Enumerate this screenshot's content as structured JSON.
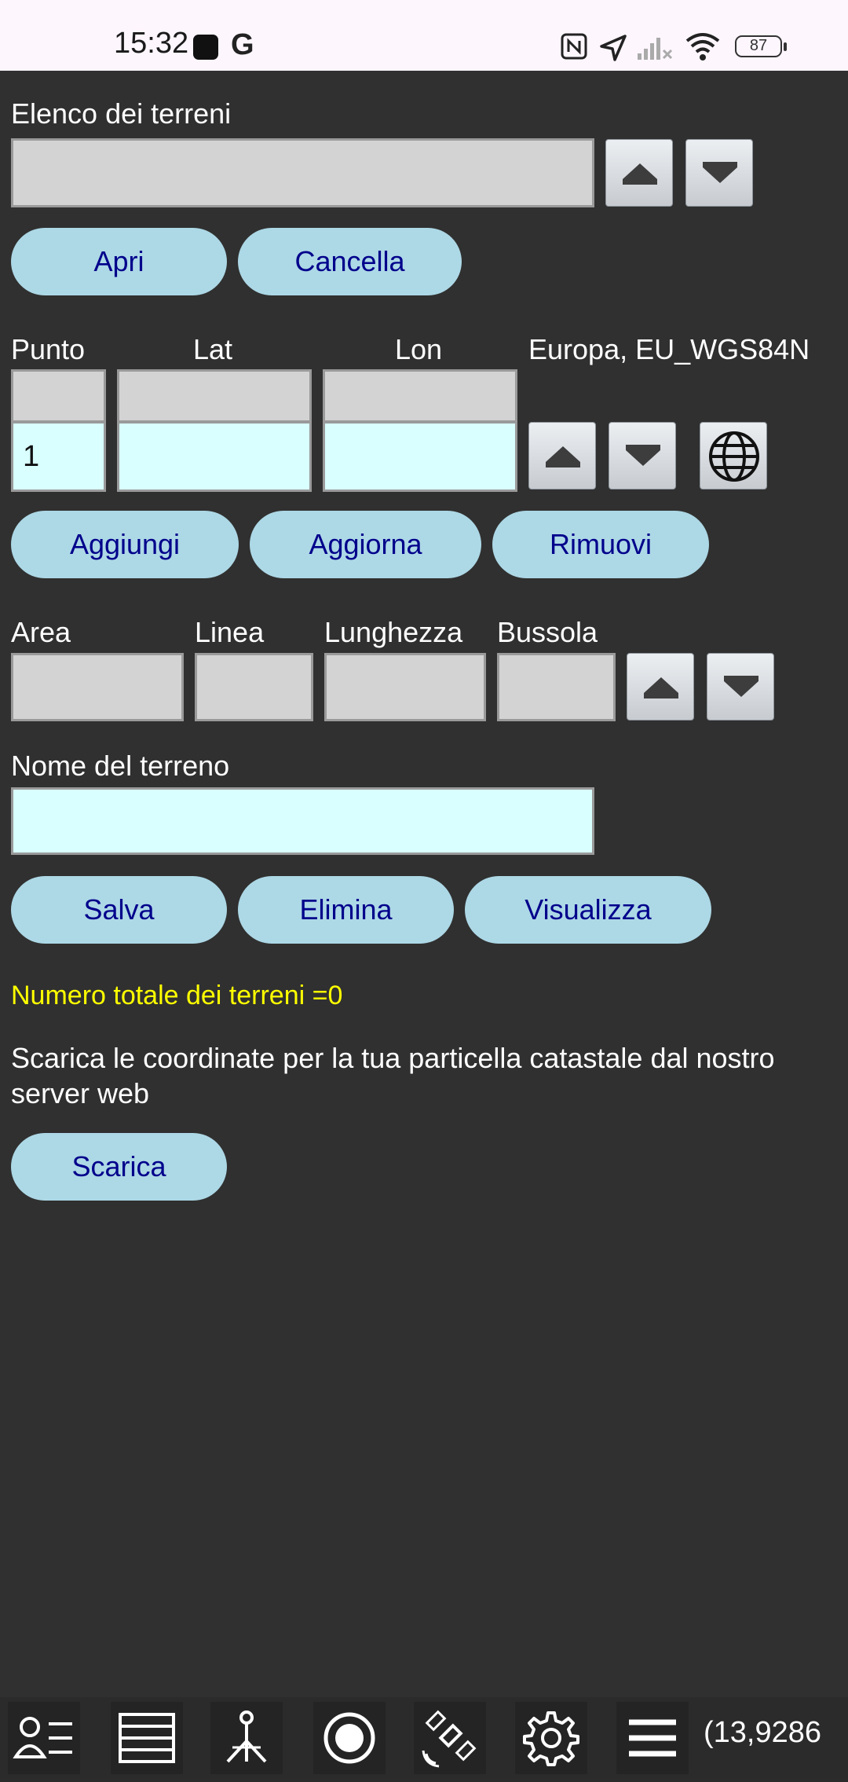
{
  "status_bar": {
    "time": "15:32",
    "battery_level": "87",
    "icons": [
      "app-notification-icon",
      "google-icon",
      "nfc-icon",
      "location-arrow-icon",
      "signal-icon",
      "wifi-icon",
      "battery-icon"
    ]
  },
  "terrain_list": {
    "label": "Elenco dei terreni",
    "selected_value": "",
    "open_label": "Apri",
    "cancel_label": "Cancella"
  },
  "point_section": {
    "point_label": "Punto",
    "lat_label": "Lat",
    "lon_label": "Lon",
    "datum_label": "Europa, EU_WGS84N",
    "point_value": "1",
    "lat_value": "",
    "lon_value": "",
    "add_label": "Aggiungi",
    "update_label": "Aggiorna",
    "remove_label": "Rimuovi"
  },
  "measure_section": {
    "area_label": "Area",
    "line_label": "Linea",
    "length_label": "Lunghezza",
    "compass_label": "Bussola",
    "area_value": "",
    "line_value": "",
    "length_value": "",
    "compass_value": ""
  },
  "terrain_name": {
    "label": "Nome del terreno",
    "value": "",
    "save_label": "Salva",
    "delete_label": "Elimina",
    "view_label": "Visualizza"
  },
  "summary": {
    "total_text": "Numero totale dei terreni =0",
    "download_text": "Scarica le coordinate per la tua particella catastale dal nostro server web",
    "download_label": "Scarica"
  },
  "toolbar": {
    "icons": [
      "user-list-icon",
      "list-icon",
      "survey-icon",
      "record-icon",
      "satellite-icon",
      "settings-icon",
      "menu-icon"
    ],
    "coordinate_text": "(13,9286"
  },
  "colors": {
    "background": "#303030",
    "field_gray": "#d3d3d3",
    "field_cyan": "#d9ffff",
    "pill_bg": "#add8e6",
    "pill_text": "#00008b",
    "info_yellow": "#ffff00"
  }
}
